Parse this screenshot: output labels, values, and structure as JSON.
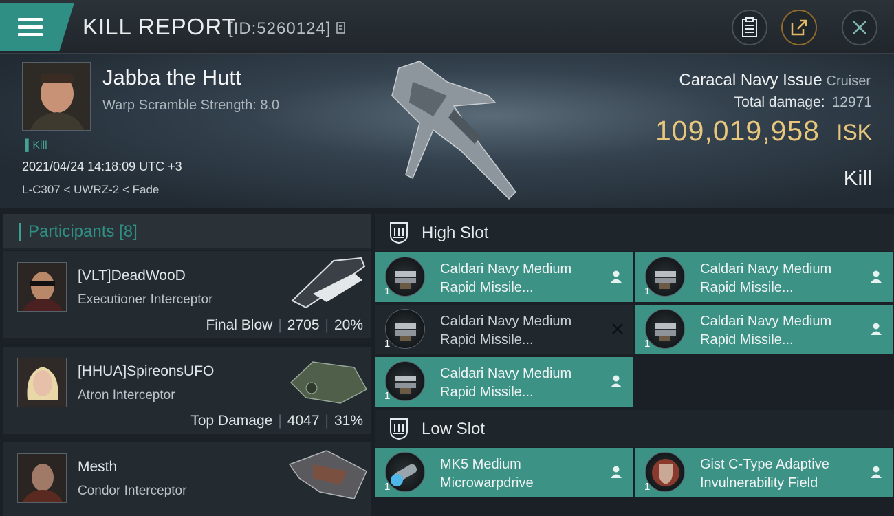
{
  "header": {
    "title": "KILL REPORT",
    "report_id": "[ID:5260124]",
    "buttons": [
      "clipboard-icon",
      "share-icon",
      "close-icon"
    ]
  },
  "victim": {
    "name": "Jabba the Hutt",
    "warp_scramble": "Warp Scramble Strength: 8.0",
    "tag": "Kill",
    "date": "2021/04/24 14:18:09 UTC +3",
    "location": "L-C307 < UWRZ-2 < Fade",
    "ship_name": "Caracal Navy Issue",
    "ship_class": "Cruiser",
    "total_damage_label": "Total damage:",
    "total_damage": "12971",
    "isk_value": "109,019,958",
    "isk_unit": "ISK",
    "result": "Kill"
  },
  "participants": {
    "label": "Participants [8]",
    "rows": [
      {
        "name": "[VLT]DeadWooD",
        "ship": "Executioner Interceptor",
        "role": "Final Blow",
        "damage": "2705",
        "percent": "20%"
      },
      {
        "name": "[HHUA]SpireonsUFO",
        "ship": "Atron Interceptor",
        "role": "Top Damage",
        "damage": "4047",
        "percent": "31%"
      },
      {
        "name": "Mesth",
        "ship": "Condor Interceptor"
      }
    ]
  },
  "fitting": {
    "high_slot_label": "High Slot",
    "low_slot_label": "Low Slot",
    "high_slot": [
      {
        "line1": "Caldari Navy Medium",
        "line2": "Rapid Missile...",
        "qty": "1",
        "state": "dropped"
      },
      {
        "line1": "Caldari Navy Medium",
        "line2": "Rapid Missile...",
        "qty": "1",
        "state": "dropped"
      },
      {
        "line1": "Caldari Navy Medium",
        "line2": "Rapid Missile...",
        "qty": "1",
        "state": "destroyed"
      },
      {
        "line1": "Caldari Navy Medium",
        "line2": "Rapid Missile...",
        "qty": "1",
        "state": "dropped"
      },
      {
        "line1": "Caldari Navy Medium",
        "line2": "Rapid Missile...",
        "qty": "1",
        "state": "dropped"
      }
    ],
    "low_slot": [
      {
        "line1": "MK5 Medium",
        "line2": "Microwarpdrive",
        "qty": "1",
        "state": "dropped"
      },
      {
        "line1": "Gist C-Type Adaptive",
        "line2": "Invulnerability Field",
        "qty": "1",
        "state": "dropped"
      }
    ]
  },
  "colors": {
    "accent": "#3d9286",
    "isk": "#e8c67c",
    "panel": "#232a30"
  }
}
